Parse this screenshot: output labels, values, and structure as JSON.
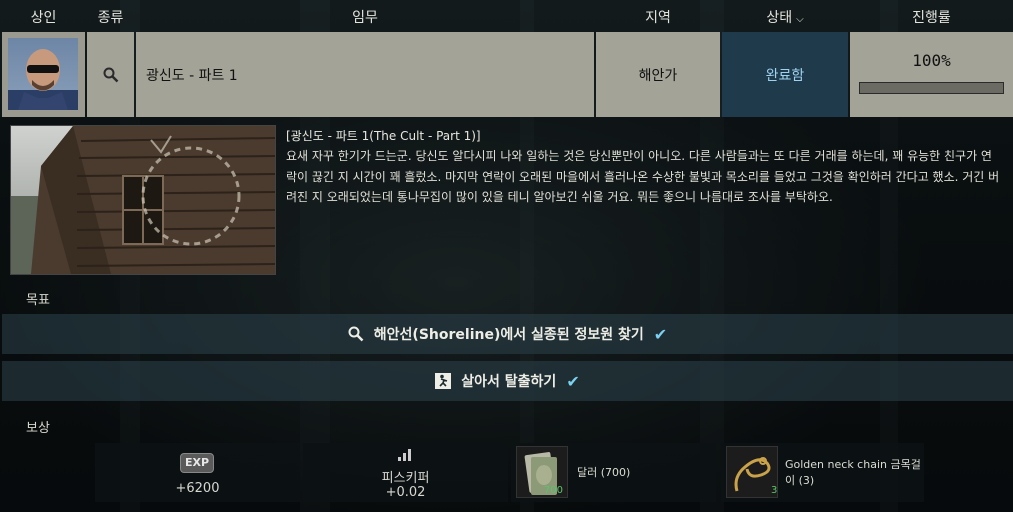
{
  "header": {
    "trader": "상인",
    "type": "종류",
    "task": "임무",
    "location": "지역",
    "status": "상태",
    "progress": "진행률"
  },
  "quest": {
    "name": "광신도 - 파트 1",
    "location": "해안가",
    "status": "완료함",
    "progress_text": "100%",
    "progress_value": 1.0,
    "title": "[광신도 - 파트 1(The Cult - Part 1)]",
    "description": "요새 자꾸 한기가 드는군. 당신도 알다시피 나와 일하는 것은 당신뿐만이 아니오. 다른 사람들과는 또 다른 거래를 하는데, 꽤 유능한 친구가 연락이 끊긴 지 시간이 꽤 흘렀소. 마지막 연락이 오래된 마을에서 흘러나온 수상한 불빛과 목소리를 들었고 그것을 확인하러 간다고 했소. 거긴 버려진 지 오래되었는데 통나무집이 많이 있을 테니 알아보긴 쉬울 거요. 뭐든 좋으니 나름대로 조사를 부탁하오."
  },
  "objectives": {
    "heading": "목표",
    "items": [
      {
        "label": "해안선(Shoreline)에서 실종된 정보원 찾기",
        "icon": "search-icon"
      },
      {
        "label": "살아서 탈출하기",
        "icon": "exit-icon"
      }
    ]
  },
  "rewards": {
    "heading": "보상",
    "exp": {
      "badge": "EXP",
      "value": "+6200"
    },
    "skill": {
      "label": "피스키퍼",
      "value": "+0.02"
    },
    "money": {
      "label": "달러 (700)",
      "count": "700"
    },
    "chain": {
      "label": "Golden neck chain 금목걸이 (3)",
      "count": "3"
    }
  },
  "colors": {
    "status_bg": "#1e3a4b",
    "status_text": "#9fd2ee",
    "check": "#7cd0f0",
    "count_green": "#59c46a"
  }
}
